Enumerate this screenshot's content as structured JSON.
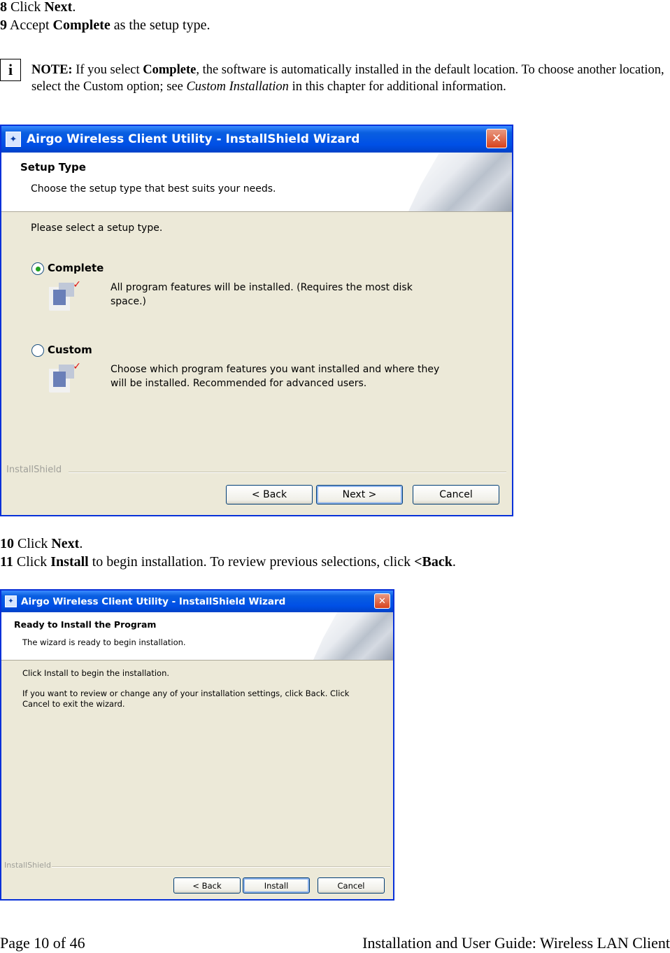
{
  "steps": [
    {
      "num": "8",
      "pre": " Click ",
      "bold": "Next",
      "post": "."
    },
    {
      "num": "9",
      "pre": " Accept ",
      "bold": "Complete",
      "post": " as the setup type."
    },
    {
      "num": "10",
      "pre": " Click ",
      "bold": "Next",
      "post": "."
    },
    {
      "num": "11",
      "pre": " Click ",
      "bold": "Install",
      "post": " to begin installation. To review previous selections, click ",
      "bold2": "<Back",
      "post2": "."
    }
  ],
  "note": {
    "icon": "info-icon",
    "label": "NOTE:",
    "t1": " If you select ",
    "bold": "Complete",
    "t2": ", the software is automatically installed in the default location. To choose another location, select the Custom option; see ",
    "italic": "Custom Installation",
    "t3": " in this chapter for additional information."
  },
  "wizard1": {
    "title": "Airgo Wireless Client Utility - InstallShield Wizard",
    "header_title": "Setup Type",
    "header_subtitle": "Choose the setup type that best suits your needs.",
    "prompt": "Please select a setup type.",
    "options": [
      {
        "label": "Complete",
        "description": "All program features will be installed. (Requires the most disk space.)",
        "selected": true
      },
      {
        "label": "Custom",
        "description": "Choose which program features you want installed and where they will be installed. Recommended for advanced users.",
        "selected": false
      }
    ],
    "brand": "InstallShield",
    "buttons": {
      "back": "< Back",
      "next": "Next >",
      "cancel": "Cancel"
    }
  },
  "wizard2": {
    "title": "Airgo Wireless Client Utility - InstallShield Wizard",
    "header_title": "Ready to Install the Program",
    "header_subtitle": "The wizard is ready to begin installation.",
    "line1": "Click Install to begin the installation.",
    "line2": "If you want to review or change any of your installation settings, click Back. Click Cancel to exit the wizard.",
    "brand": "InstallShield",
    "buttons": {
      "back": "< Back",
      "install": "Install",
      "cancel": "Cancel"
    }
  },
  "footer": {
    "left": "Page 10 of 46",
    "right": "Installation and User Guide:  Wireless LAN Client"
  },
  "colors": {
    "titlebar": "#0050e6",
    "dialog_face": "#ece9d8",
    "close": "#d8421c"
  }
}
